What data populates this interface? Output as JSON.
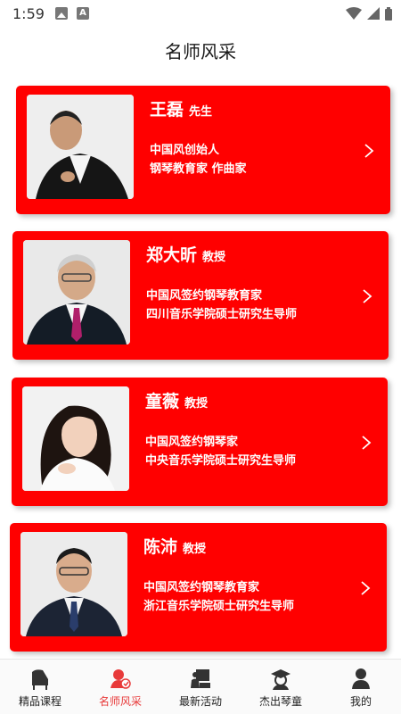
{
  "status_bar": {
    "time": "1:59"
  },
  "header": {
    "title": "名师风采"
  },
  "teachers": [
    {
      "name": "王磊",
      "title": "先生",
      "desc1": "中国风创始人",
      "desc2": "钢琴教育家 作曲家"
    },
    {
      "name": "郑大昕",
      "title": "教授",
      "desc1": "中国风签约钢琴教育家",
      "desc2": "四川音乐学院硕士研究生导师"
    },
    {
      "name": "童薇",
      "title": "教授",
      "desc1": "中国风签约钢琴家",
      "desc2": "中央音乐学院硕士研究生导师"
    },
    {
      "name": "陈沛",
      "title": "教授",
      "desc1": "中国风签约钢琴教育家",
      "desc2": "浙江音乐学院硕士研究生导师"
    }
  ],
  "bottom_nav": {
    "items": [
      {
        "label": "精品课程",
        "icon": "piano-icon"
      },
      {
        "label": "名师风采",
        "icon": "teacher-icon"
      },
      {
        "label": "最新活动",
        "icon": "activity-icon"
      },
      {
        "label": "杰出琴童",
        "icon": "graduate-icon"
      },
      {
        "label": "我的",
        "icon": "user-icon"
      }
    ],
    "active_index": 1
  },
  "colors": {
    "card_red": "#ff0000",
    "active_tab": "#e83a3a"
  }
}
